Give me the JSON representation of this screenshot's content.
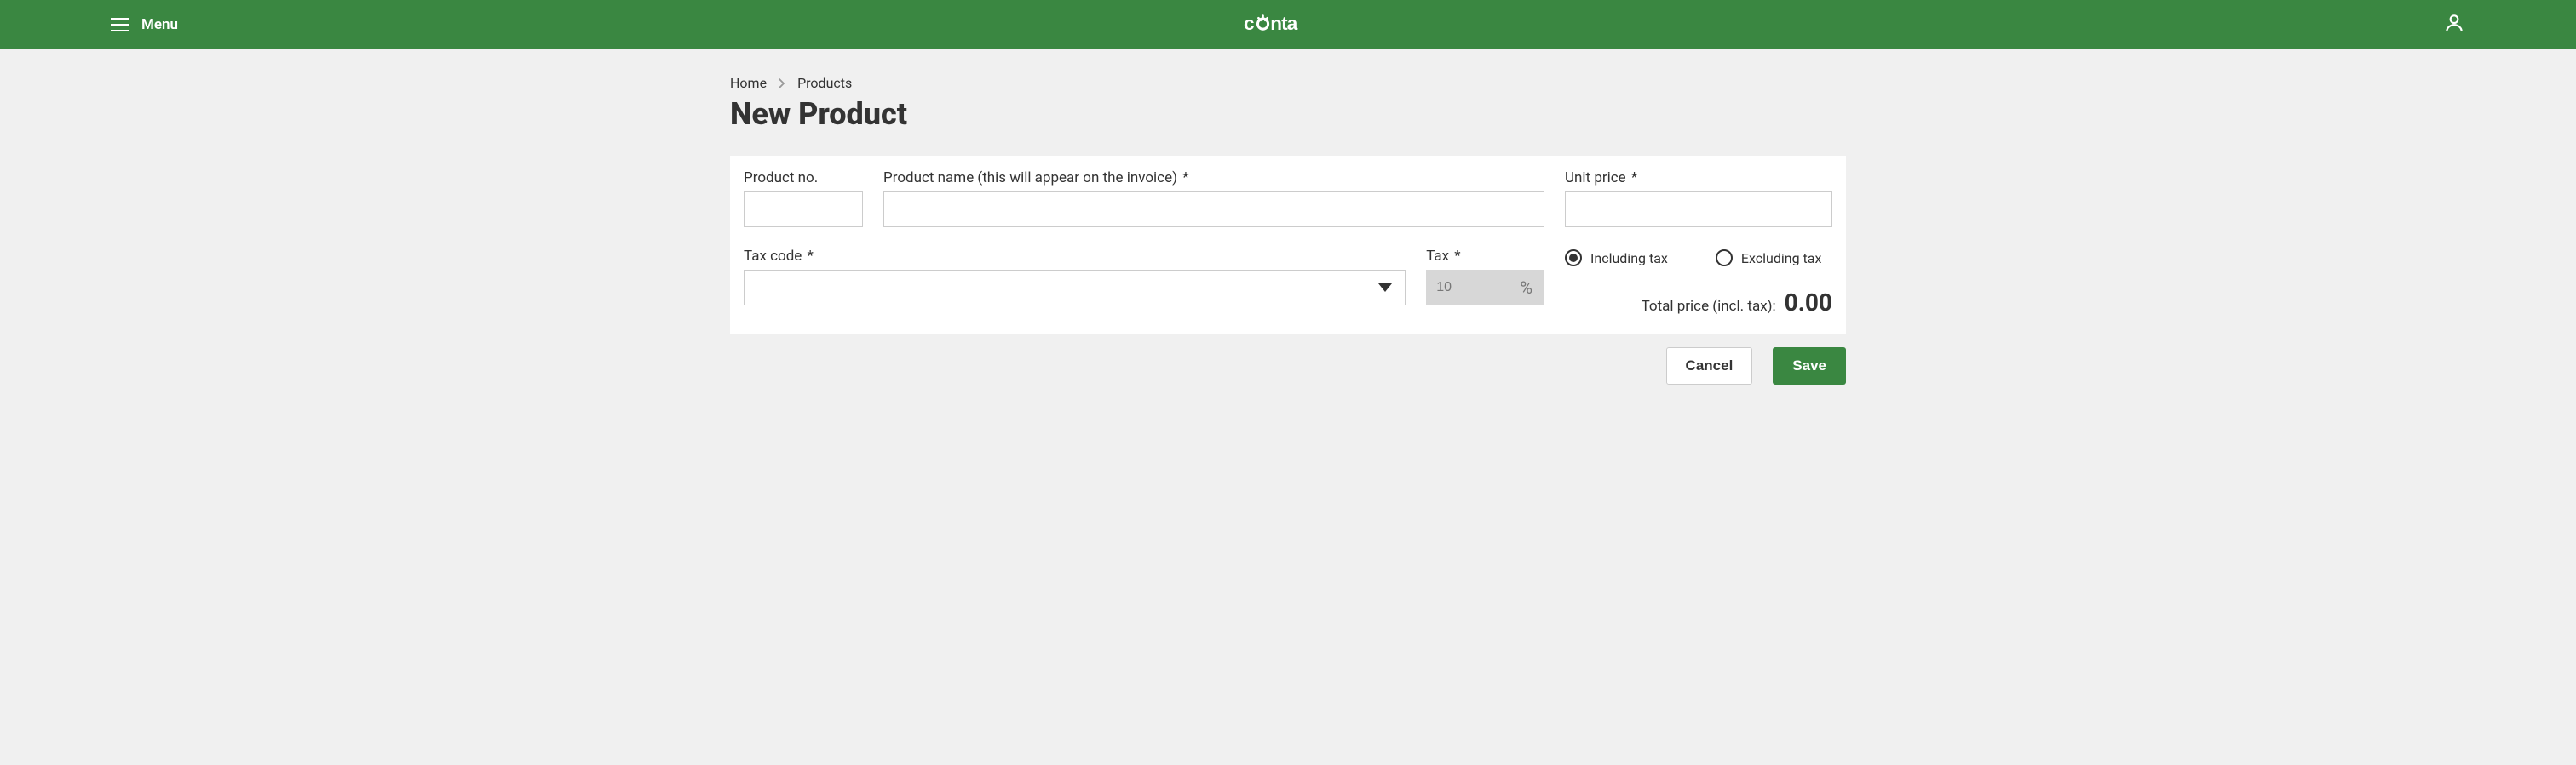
{
  "header": {
    "menu_label": "Menu",
    "brand": "conta"
  },
  "breadcrumb": {
    "home": "Home",
    "products": "Products"
  },
  "page": {
    "title": "New Product"
  },
  "form": {
    "product_no": {
      "label": "Product no.",
      "value": ""
    },
    "product_name": {
      "label": "Product name (this will appear on the invoice)",
      "required": "*",
      "value": ""
    },
    "unit_price": {
      "label": "Unit price",
      "required": "*",
      "value": ""
    },
    "tax_code": {
      "label": "Tax code",
      "required": "*",
      "value": ""
    },
    "tax": {
      "label": "Tax",
      "required": "*",
      "value": "10",
      "suffix": "%"
    },
    "tax_mode": {
      "including": "Including tax",
      "excluding": "Excluding tax",
      "selected": "including"
    },
    "total": {
      "label": "Total price (incl. tax):",
      "value": "0.00"
    }
  },
  "actions": {
    "cancel": "Cancel",
    "save": "Save"
  }
}
